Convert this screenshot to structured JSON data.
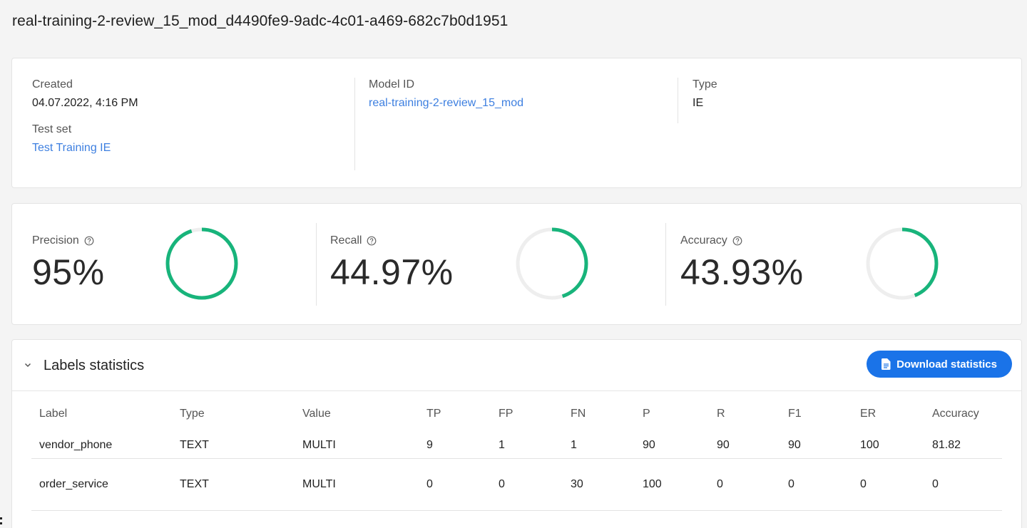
{
  "page": {
    "title": "real-training-2-review_15_mod_d4490fe9-9adc-4c01-a469-682c7b0d1951"
  },
  "info": {
    "created_label": "Created",
    "created_value": "04.07.2022, 4:16 PM",
    "test_set_label": "Test set",
    "test_set_value": "Test Training IE",
    "model_id_label": "Model ID",
    "model_id_value": "real-training-2-review_15_mod",
    "type_label": "Type",
    "type_value": "IE"
  },
  "metrics": [
    {
      "label": "Precision",
      "value": "95%",
      "fraction": 0.95
    },
    {
      "label": "Recall",
      "value": "44.97%",
      "fraction": 0.4497
    },
    {
      "label": "Accuracy",
      "value": "43.93%",
      "fraction": 0.4393
    }
  ],
  "colors": {
    "ring_fill": "#18b47b",
    "ring_track": "#eeeeee",
    "accent": "#1a73e8",
    "link": "#3d7fe0"
  },
  "icons": {
    "help": "help-circle-icon",
    "chevron": "chevron-down-icon",
    "download": "document-icon"
  },
  "stats": {
    "title": "Labels statistics",
    "download_label": "Download statistics",
    "columns": [
      "Label",
      "Type",
      "Value",
      "TP",
      "FP",
      "FN",
      "P",
      "R",
      "F1",
      "ER",
      "Accuracy"
    ],
    "rows": [
      [
        "vendor_phone",
        "TEXT",
        "MULTI",
        "9",
        "1",
        "1",
        "90",
        "90",
        "90",
        "100",
        "81.82"
      ],
      [
        "order_service",
        "TEXT",
        "MULTI",
        "0",
        "0",
        "30",
        "100",
        "0",
        "0",
        "0",
        "0"
      ]
    ]
  }
}
